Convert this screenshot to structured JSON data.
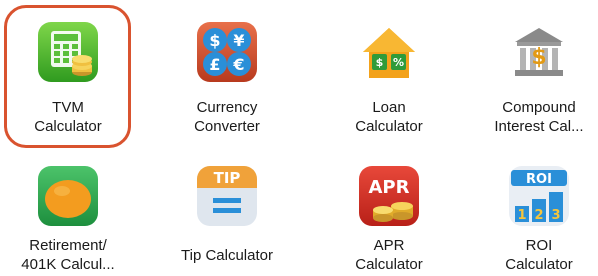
{
  "apps": [
    {
      "id": "tvm",
      "line1": "TVM",
      "line2": "Calculator",
      "icon": "calculator-coins-icon",
      "selected": true
    },
    {
      "id": "currency",
      "line1": "Currency",
      "line2": "Converter",
      "icon": "currency-symbols-icon"
    },
    {
      "id": "loan",
      "line1": "Loan",
      "line2": "Calculator",
      "icon": "house-percent-icon"
    },
    {
      "id": "compound",
      "line1": "Compound",
      "line2": "Interest Cal...",
      "icon": "bank-dollar-icon"
    },
    {
      "id": "retirement",
      "line1": "Retirement/",
      "line2": "401K Calcul...",
      "icon": "nest-egg-icon"
    },
    {
      "id": "tip",
      "line1": "Tip Calculator",
      "line2": "",
      "icon": "tip-equals-icon"
    },
    {
      "id": "apr",
      "line1": "APR",
      "line2": "Calculator",
      "icon": "apr-coins-icon"
    },
    {
      "id": "roi",
      "line1": "ROI",
      "line2": "Calculator",
      "icon": "roi-bars-icon"
    }
  ],
  "icon_text": {
    "tip": "TIP",
    "apr": "APR",
    "roi": "ROI",
    "roi_digits": [
      "1",
      "2",
      "3"
    ],
    "loan_symbols": [
      "$",
      "%"
    ],
    "currency_symbols": [
      "$",
      "¥",
      "£",
      "€"
    ]
  },
  "colors": {
    "highlight": "#d9532f"
  }
}
